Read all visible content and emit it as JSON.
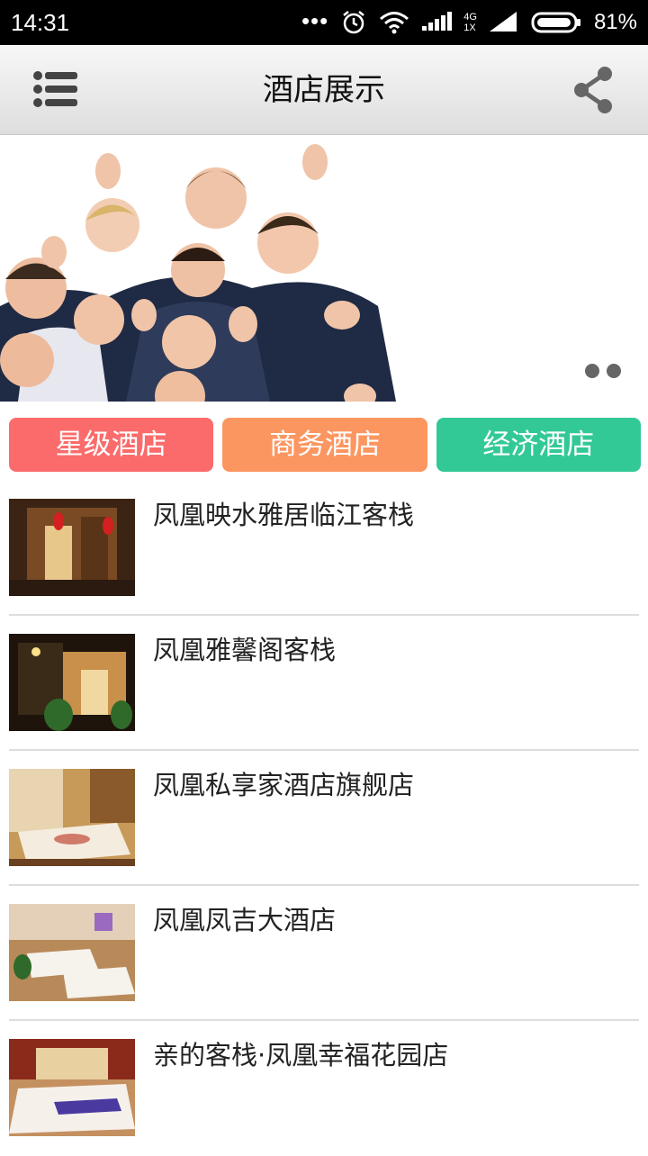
{
  "status_bar": {
    "time": "14:31",
    "dots": "•••",
    "network_type": "4G",
    "network_sub": "1X",
    "battery_percent": "81%",
    "icons": [
      "alarm-icon",
      "wifi-icon",
      "signal-icon",
      "battery-icon"
    ]
  },
  "header": {
    "title": "酒店展示",
    "menu_icon": "list-menu-icon",
    "share_icon": "share-icon"
  },
  "banner": {
    "image": "crowd-thumbs-up-photo",
    "dots_count": 2
  },
  "categories": [
    {
      "label": "星级酒店",
      "color": "#fb6b6b"
    },
    {
      "label": "商务酒店",
      "color": "#fc9660"
    },
    {
      "label": "经济酒店",
      "color": "#33c996"
    }
  ],
  "hotels": [
    {
      "name": "凤凰映水雅居临江客栈",
      "thumb": "hotel-lobby-photo"
    },
    {
      "name": "凤凰雅馨阁客栈",
      "thumb": "hotel-entrance-photo"
    },
    {
      "name": "凤凰私享家酒店旗舰店",
      "thumb": "hotel-bedroom-photo"
    },
    {
      "name": "凤凰凤吉大酒店",
      "thumb": "hotel-twin-room-photo"
    },
    {
      "name": "亲的客栈·凤凰幸福花园店",
      "thumb": "hotel-double-room-photo"
    }
  ]
}
